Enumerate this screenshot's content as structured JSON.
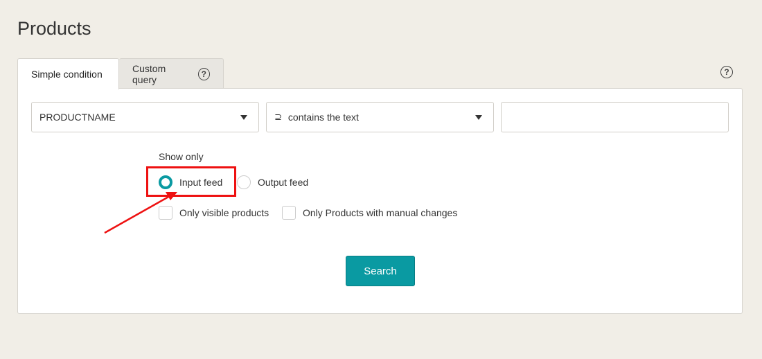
{
  "page": {
    "title": "Products"
  },
  "tabs": [
    {
      "label": "Simple condition",
      "active": true
    },
    {
      "label": "Custom query",
      "active": false
    }
  ],
  "help_icon_glyph": "?",
  "condition": {
    "field": "PRODUCTNAME",
    "operator_symbol": "⊇",
    "operator": "contains the text",
    "value": ""
  },
  "show_only": {
    "label": "Show only",
    "radios": [
      {
        "label": "Input feed",
        "checked": true
      },
      {
        "label": "Output feed",
        "checked": false
      }
    ],
    "checkboxes": [
      {
        "label": "Only visible products",
        "checked": false
      },
      {
        "label": "Only Products with manual changes",
        "checked": false
      }
    ]
  },
  "search_button": "Search",
  "colors": {
    "accent": "#0a9aa2",
    "annotation": "#ee1111",
    "background": "#f1eee7"
  }
}
